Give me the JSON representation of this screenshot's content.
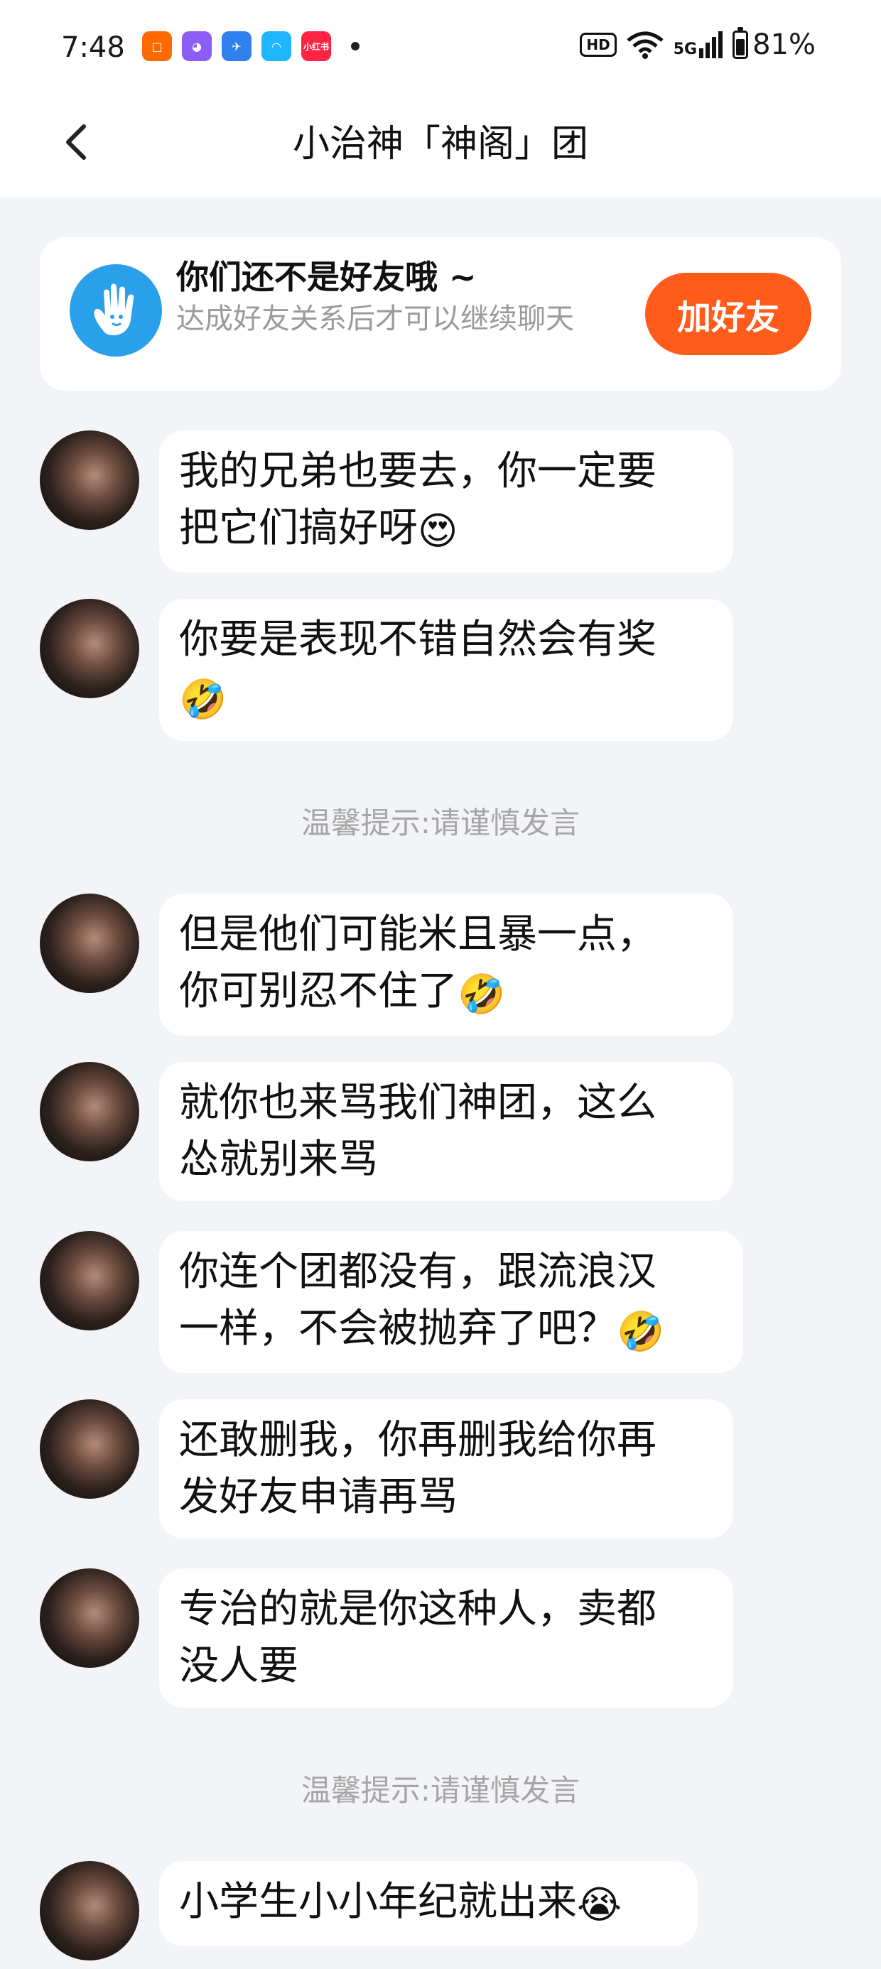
{
  "status_bar": {
    "time": "7:48",
    "app_icons": [
      {
        "name": "grid-app-icon",
        "color": "#ff6a00",
        "label": "□"
      },
      {
        "name": "cat-app-icon",
        "color": "#8b5cf6",
        "label": "◕"
      },
      {
        "name": "feather-app-icon",
        "color": "#2f80ed",
        "label": "✈"
      },
      {
        "name": "swirl-app-icon",
        "color": "#1fb5ff",
        "label": "◠"
      },
      {
        "name": "xiaohongshu-app-icon",
        "color": "#ff2442",
        "label": "小红书"
      }
    ],
    "hd": "HD",
    "network": "5G",
    "battery": "81%",
    "battery_level": 0.81
  },
  "header": {
    "title": "小治神「神阁」团"
  },
  "banner": {
    "title": "你们还不是好友哦 ~",
    "subtitle": "达成好友关系后才可以继续聊天",
    "button": "加好友",
    "accent": "#ff5b1a"
  },
  "messages": [
    {
      "text": "我的兄弟也要去，你一定要\n把它们搞好呀",
      "emoji": "😍"
    },
    {
      "text": "你要是表现不错自然会有奖\n",
      "emoji": "🤣"
    },
    {
      "notice": "温馨提示:请谨慎发言"
    },
    {
      "text": "但是他们可能米且暴一点，\n你可别忍不住了",
      "emoji": "🤣"
    },
    {
      "text": "就你也来骂我们神团，这么\n怂就别来骂",
      "emoji": ""
    },
    {
      "text": "你连个团都没有，跟流浪汉\n一样，不会被抛弃了吧？",
      "emoji": "🤣"
    },
    {
      "text": "还敢删我，你再删我给你再\n发好友申请再骂",
      "emoji": ""
    },
    {
      "text": "专治的就是你这种人，卖都\n没人要",
      "emoji": ""
    },
    {
      "notice": "温馨提示:请谨慎发言"
    },
    {
      "text": "小学生小小年纪就出来",
      "emoji": "😭"
    }
  ]
}
